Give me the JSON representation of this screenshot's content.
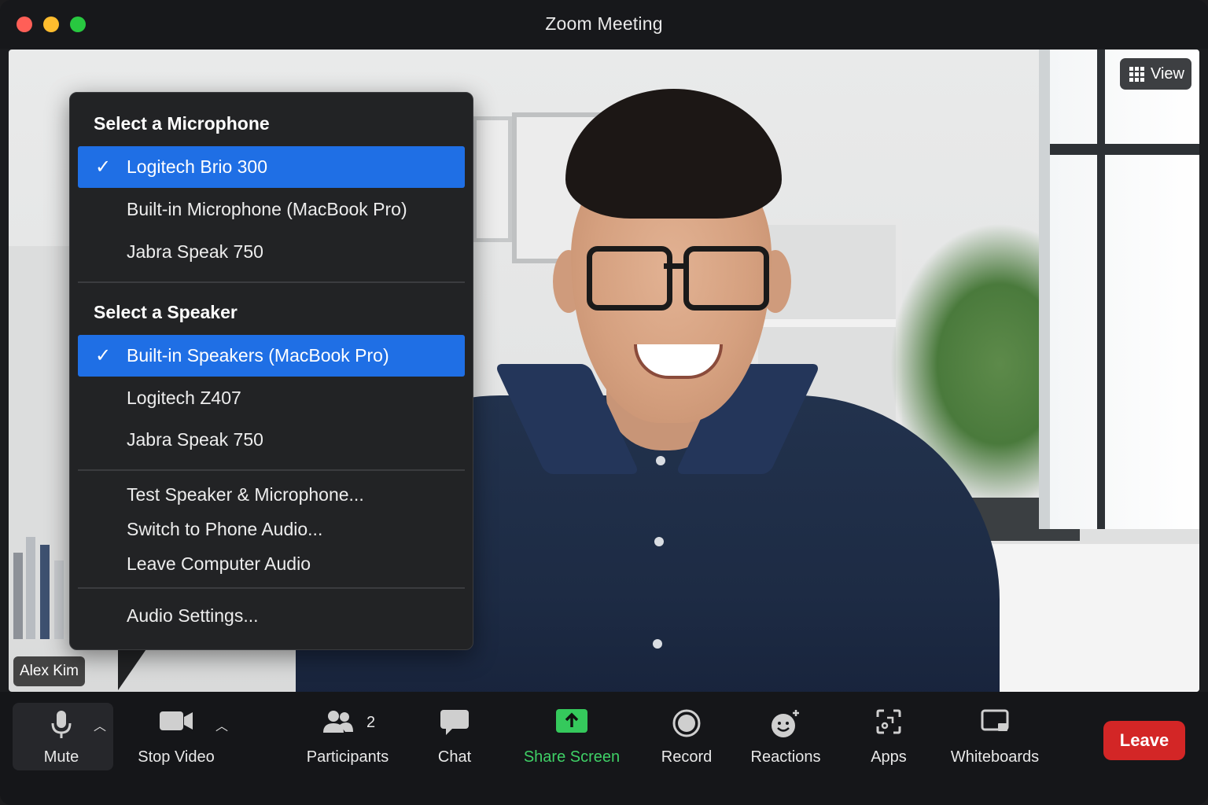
{
  "window": {
    "title": "Zoom Meeting"
  },
  "video": {
    "participant_name": "Alex Kim",
    "view_label": "View"
  },
  "audio_menu": {
    "microphone_heading": "Select a Microphone",
    "microphones": [
      {
        "label": "Logitech Brio 300",
        "selected": true
      },
      {
        "label": "Built-in Microphone (MacBook Pro)",
        "selected": false
      },
      {
        "label": "Jabra Speak 750",
        "selected": false
      }
    ],
    "speaker_heading": "Select a Speaker",
    "speakers": [
      {
        "label": "Built-in Speakers (MacBook Pro)",
        "selected": true
      },
      {
        "label": "Logitech Z407",
        "selected": false
      },
      {
        "label": "Jabra Speak 750",
        "selected": false
      }
    ],
    "actions": [
      "Test Speaker & Microphone...",
      "Switch to Phone Audio...",
      "Leave Computer Audio"
    ],
    "settings": "Audio Settings...",
    "check_glyph": "✓"
  },
  "toolbar": {
    "mute": "Mute",
    "stop_video": "Stop Video",
    "participants": "Participants",
    "participants_count": "2",
    "chat": "Chat",
    "share_screen": "Share Screen",
    "record": "Record",
    "reactions": "Reactions",
    "apps": "Apps",
    "whiteboards": "Whiteboards",
    "leave": "Leave"
  },
  "colors": {
    "menu_selected": "#1f6fe5",
    "share_green": "#3fd066",
    "leave_red": "#d32626"
  }
}
